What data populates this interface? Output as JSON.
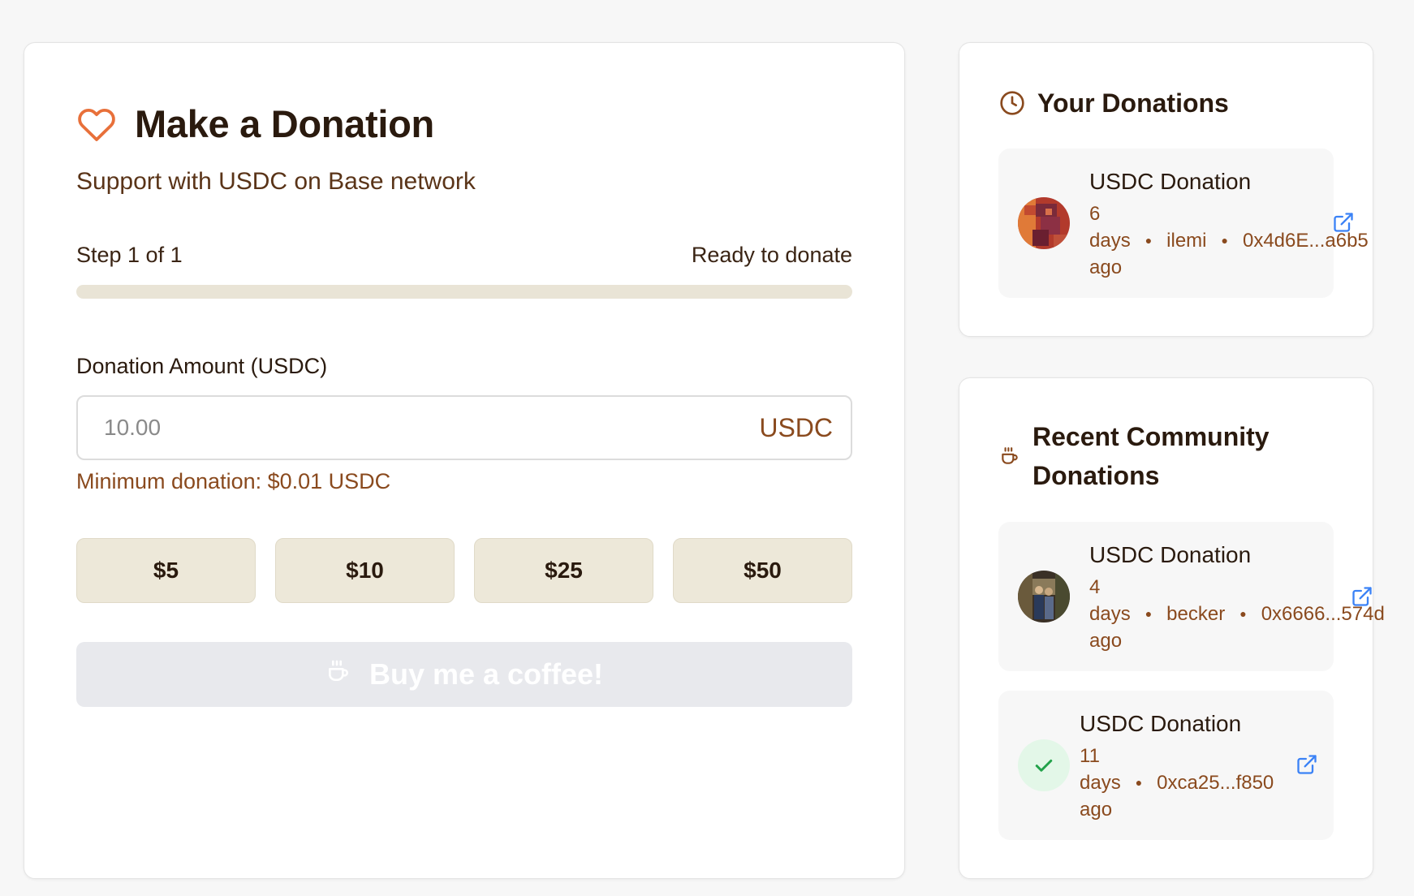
{
  "donate": {
    "title": "Make a Donation",
    "subtitle": "Support with USDC on Base network",
    "step_label": "Step 1 of 1",
    "status_label": "Ready to donate",
    "progress": 0,
    "amount_label": "Donation Amount (USDC)",
    "amount_placeholder": "10.00",
    "amount_value": "",
    "unit": "USDC",
    "min_note": "Minimum donation: $0.01 USDC",
    "presets": [
      "$5",
      "$10",
      "$25",
      "$50"
    ],
    "submit_label": "Buy me a coffee!"
  },
  "your_donations": {
    "title": "Your Donations",
    "items": [
      {
        "title": "USDC Donation",
        "ago_num": "6",
        "ago_unit": "days",
        "ago_word": "ago",
        "user": "ilemi",
        "address": "0x4d6E...a6b5"
      }
    ]
  },
  "community": {
    "title_line1": "Recent Community",
    "title_line2": "Donations",
    "items": [
      {
        "title": "USDC Donation",
        "ago_num": "4",
        "ago_unit": "days",
        "ago_word": "ago",
        "user": "becker",
        "address": "0x6666...574d"
      },
      {
        "title": "USDC Donation",
        "ago_num": "11",
        "ago_unit": "days",
        "ago_word": "ago",
        "address": "0xca25...f850"
      }
    ]
  },
  "colors": {
    "accent": "#e8703a",
    "brown": "#8a4a1e",
    "link": "#3b82f6",
    "success": "#22a24a"
  },
  "icons": {
    "title": "heart-icon",
    "submit": "coffee-icon",
    "your_donations": "clock-icon",
    "community": "coffee-icon",
    "item_link": "external-link-icon",
    "item_status": "check-icon"
  }
}
